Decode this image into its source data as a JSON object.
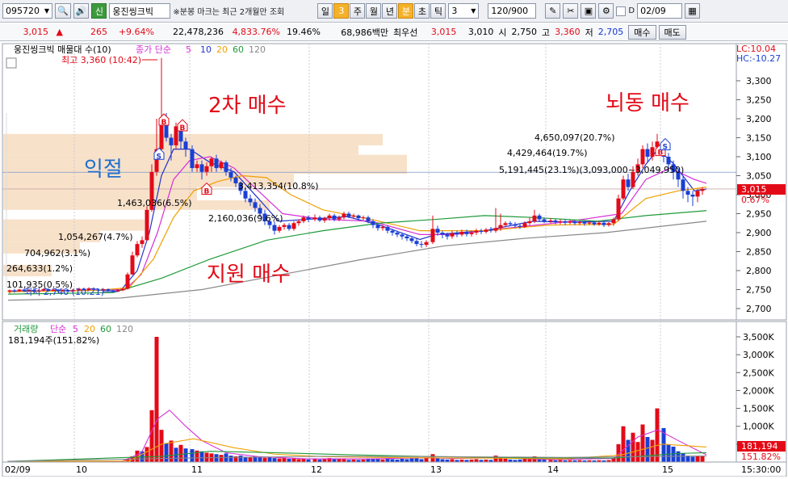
{
  "toolbar": {
    "code": "095720",
    "stock_name": "웅진씽크빅",
    "marquee": "※분봉 마크는 최근 2개월만 조회",
    "period_tabs": [
      "일",
      "3",
      "주",
      "월",
      "년",
      "분",
      "초",
      "틱"
    ],
    "period_value": "3",
    "count": "120/900",
    "date": "02/09",
    "search_icon": "search-icon",
    "speaker_icon": "speaker-icon",
    "credit_badge": "신"
  },
  "quote": {
    "price": "3,015",
    "arrow": "▲",
    "change": "265",
    "change_pct": "+9.64%",
    "volume": "22,478,236",
    "volume_ratio": "4,833.76%",
    "turnover": "19.46%",
    "amount": "68,986백만",
    "best_label": "최우선",
    "ask": "3,015",
    "bid": "3,010",
    "open_label": "시",
    "open": "2,750",
    "high_label": "고",
    "high": "3,360",
    "low_label": "저",
    "low": "2,705",
    "buy_button": "매수",
    "sell_button": "매도"
  },
  "price_panel": {
    "legend_name": "웅진씽크빅 매물대 수(10)",
    "legend_ma": "종가 단순",
    "ma_periods": [
      "5",
      "10",
      "20",
      "60",
      "120"
    ],
    "lc": "LC:10.04",
    "hc": "HC:-10.27",
    "max_note": "최고 3,360 (10:42)",
    "min_note": "최저 2,740 (10:21)",
    "current_label": "3,015",
    "current_pct": "0.67%",
    "y_ticks": [
      "3,300",
      "3,250",
      "3,200",
      "3,150",
      "3,100",
      "3,050",
      "3,000",
      "2,950",
      "2,900",
      "2,850",
      "2,800",
      "2,750",
      "2,700"
    ],
    "profile_labels": [
      "4,650,097(20.7%)",
      "4,429,464(19.7%)",
      "5,191,445(23.1%)(3,093,000~3,049,950)",
      "3,413,354(10.8%)",
      "1,463,036(6.5%)",
      "2,160,036(9.6%)",
      "1,054,267(4.7%)",
      "704,962(3.1%)",
      "264,633(1.2%)",
      "101,935(0.5%)"
    ],
    "annotations": [
      "2차 매수",
      "익절",
      "지원 매수",
      "뇌동 매수"
    ],
    "signal_marks": [
      "B",
      "B",
      "B",
      "S",
      "B",
      "S"
    ]
  },
  "volume_panel": {
    "legend_name": "거래량",
    "legend_ma": "단순",
    "ma_periods": [
      "5",
      "20",
      "60",
      "120"
    ],
    "value": "181,194주(151.82%)",
    "current_label": "181,194",
    "current_pct": "151.82%",
    "y_ticks": [
      "3,500K",
      "3,000K",
      "2,500K",
      "2,000K",
      "1,500K",
      "1,000K",
      "500,000"
    ]
  },
  "x_axis": {
    "labels": [
      "02/09",
      "10",
      "11",
      "12",
      "13",
      "14",
      "15"
    ],
    "time": "15:30:00"
  },
  "colors": {
    "up": "#e30a17",
    "down": "#1a3fd4",
    "ma5": "#2233cc",
    "ma10": "#d62fd6",
    "ma20": "#f0a000",
    "ma60": "#1f9a3a",
    "ma120": "#888888",
    "profile": "#f6dcc0",
    "annotation": "#e30a17",
    "annotation_blue": "#1f6fd0"
  }
}
